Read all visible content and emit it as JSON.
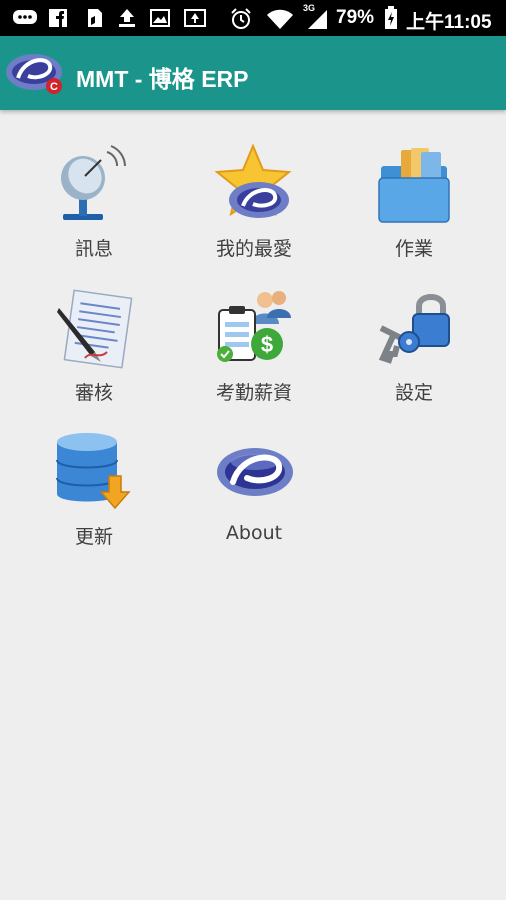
{
  "status_bar": {
    "battery": "79%",
    "time": "上午11:05",
    "network": "3G",
    "icons": [
      "chat-icon",
      "facebook-icon",
      "ebook-icon",
      "upload-icon",
      "image-icon",
      "screen-icon",
      "alarm-icon",
      "wifi-icon",
      "signal-icon",
      "battery-icon"
    ]
  },
  "app_bar": {
    "title": "MMT - 博格 ERP",
    "logo": "mmt-logo-icon",
    "color": "#1b958c"
  },
  "menu": {
    "items": [
      {
        "label": "訊息",
        "icon": "satellite-dish-icon"
      },
      {
        "label": "我的最愛",
        "icon": "favorite-star-icon"
      },
      {
        "label": "作業",
        "icon": "folder-icon"
      },
      {
        "label": "審核",
        "icon": "document-pen-icon"
      },
      {
        "label": "考勤薪資",
        "icon": "payroll-icon"
      },
      {
        "label": "設定",
        "icon": "lock-keys-icon"
      },
      {
        "label": "更新",
        "icon": "database-download-icon"
      },
      {
        "label": "About",
        "icon": "about-logo-icon"
      }
    ]
  }
}
